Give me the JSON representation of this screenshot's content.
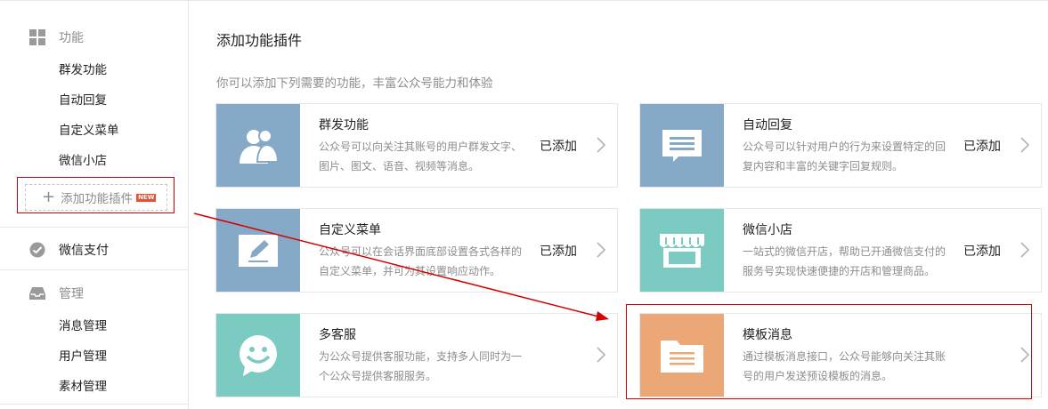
{
  "sidebar": {
    "groups": [
      {
        "label": "功能",
        "icon": "grid-icon",
        "items": [
          "群发功能",
          "自动回复",
          "自定义菜单",
          "微信小店"
        ]
      },
      {
        "label": "微信支付",
        "icon": "wechat-pay-icon",
        "items": []
      },
      {
        "label": "管理",
        "icon": "inbox-tray-icon",
        "items": [
          "消息管理",
          "用户管理",
          "素材管理"
        ]
      }
    ],
    "add_plugin": {
      "label": "添加功能插件",
      "badge": "NEW"
    }
  },
  "main": {
    "title": "添加功能插件",
    "subtitle": "你可以添加下列需要的功能，丰富公众号能力和体验",
    "cards": [
      {
        "name": "群发功能",
        "desc": "公众号可以向关注其账号的用户群发文字、图片、图文、语音、视频等消息。",
        "status": "已添加",
        "icon": "users-icon",
        "color": "#86a9c8"
      },
      {
        "name": "自动回复",
        "desc": "公众号可以针对用户的行为来设置特定的回复内容和丰富的关键字回复规则。",
        "status": "已添加",
        "icon": "chat-bubble-icon",
        "color": "#86a9c8"
      },
      {
        "name": "自定义菜单",
        "desc": "公众号可以在会话界面底部设置各式各样的自定义菜单，并可为其设置响应动作。",
        "status": "已添加",
        "icon": "pencil-icon",
        "color": "#86a9c8"
      },
      {
        "name": "微信小店",
        "desc": "一站式的微信开店，帮助已开通微信支付的服务号实现快速便捷的开店和管理商品。",
        "status": "已添加",
        "icon": "store-icon",
        "color": "#7bcbc2"
      },
      {
        "name": "多客服",
        "desc": "为公众号提供客服功能，支持多人同时为一个公众号提供客服服务。",
        "status": "",
        "icon": "smiley-bubble-icon",
        "color": "#7bcbc2"
      },
      {
        "name": "模板消息",
        "desc": "通过模板消息接口，公众号能够向关注其账号的用户发送预设模板的消息。",
        "status": "",
        "icon": "folder-document-icon",
        "color": "#eca777"
      }
    ]
  },
  "annotation": {
    "color": "#d40000"
  }
}
